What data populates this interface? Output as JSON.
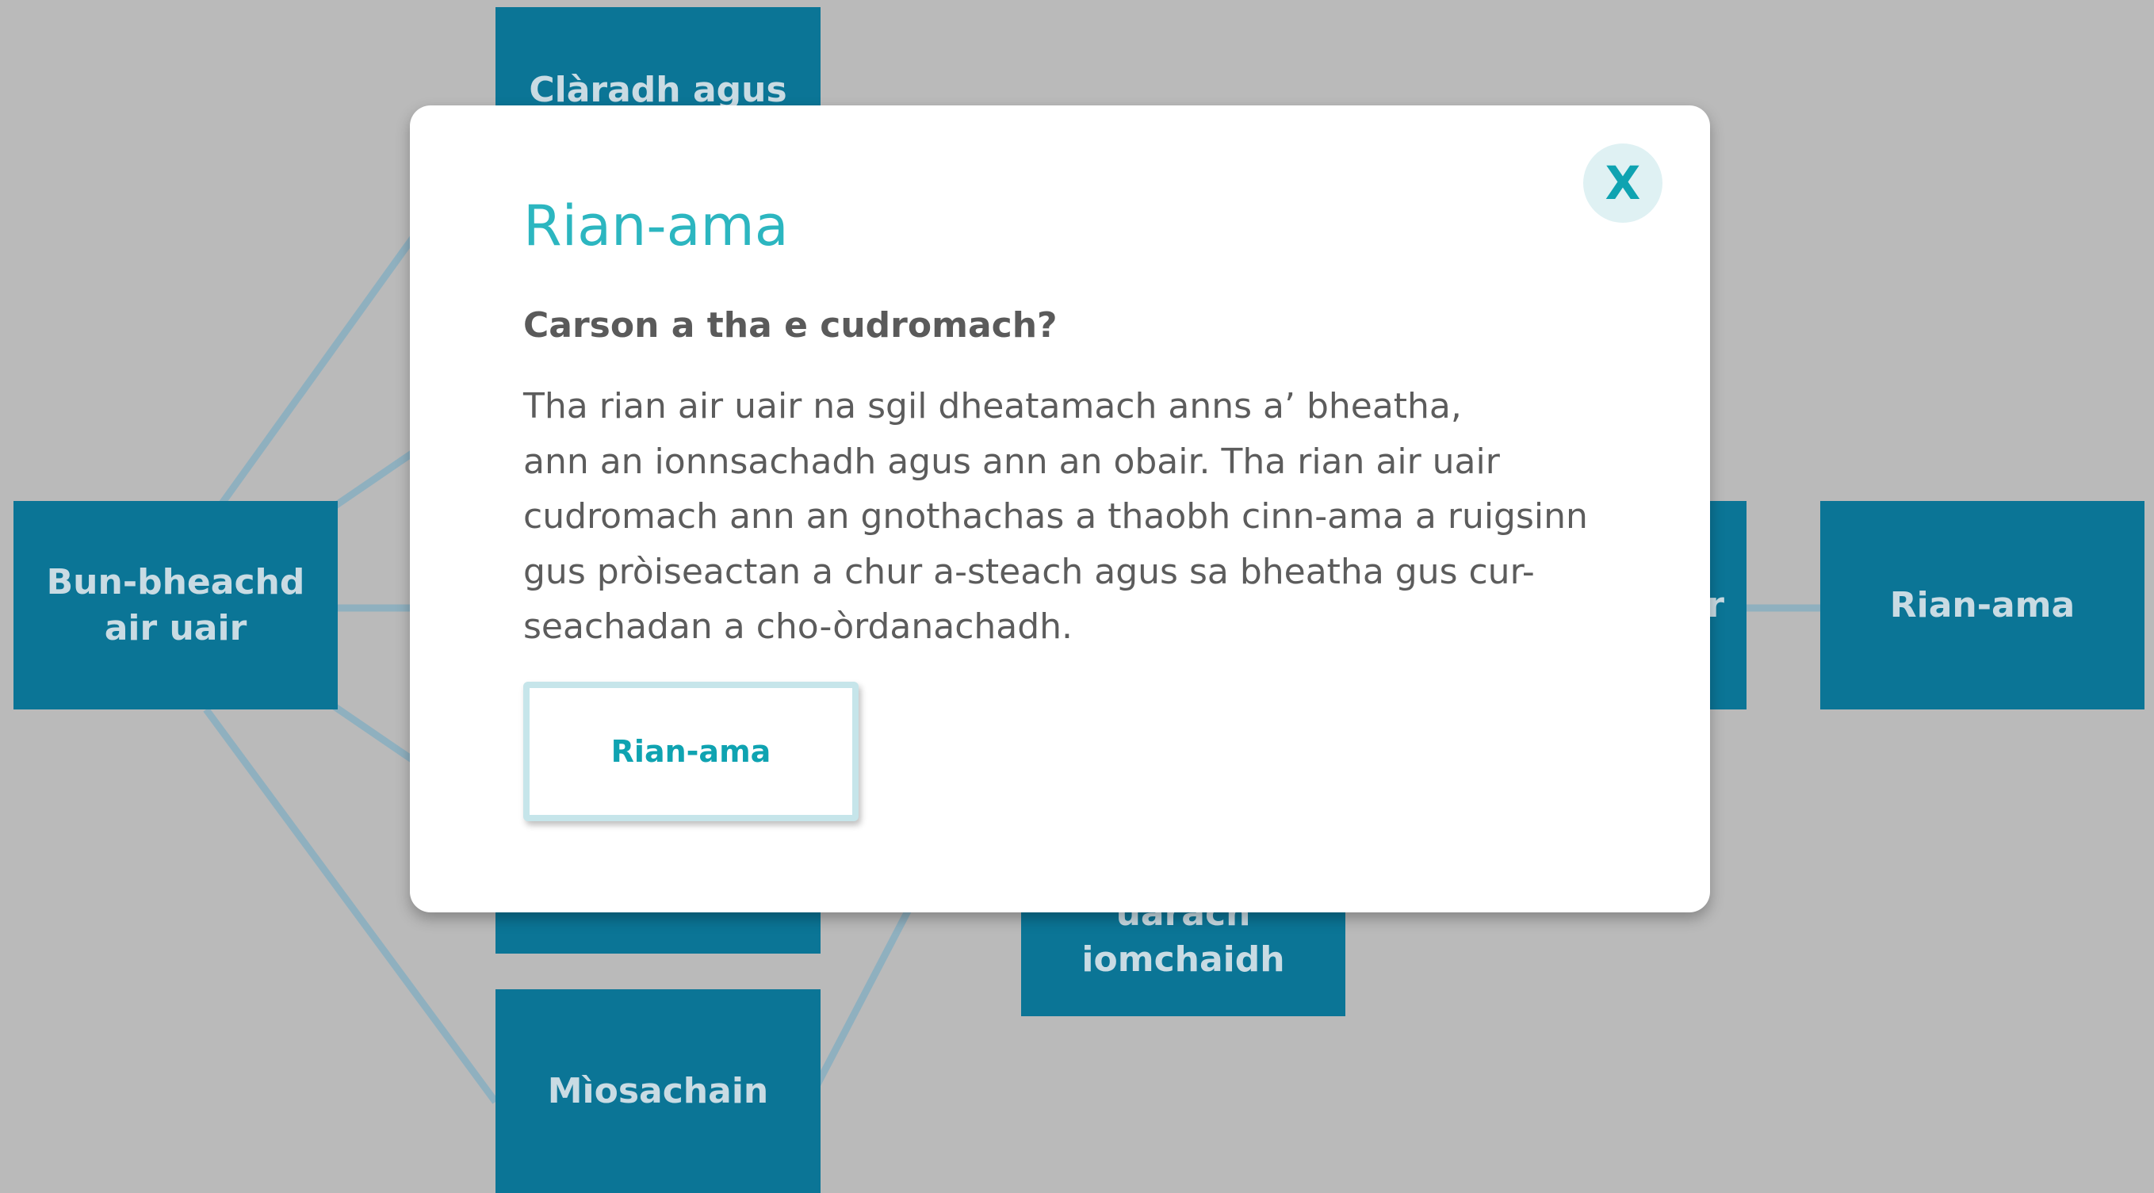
{
  "background_nodes": {
    "top_center": "Clàradh agus",
    "left": [
      "Bun-bheachd",
      "air uair"
    ],
    "right_partial": "ar",
    "right": "Rian-ama",
    "bottom_center_lines": [
      "aonadan uarach",
      "iomchaidh"
    ],
    "bottom_left": "Mìosachain"
  },
  "modal": {
    "title": "Rian-ama",
    "subtitle": "Carson a tha e cudromach?",
    "body_lines": [
      "Tha rian air uair na sgil dheatamach anns a’ bheatha,",
      "ann an ionnsachadh agus ann an obair. Tha rian air uair",
      "cudromach ann an gnothachas a thaobh cinn-ama a ruigsinn",
      "gus pròiseactan a chur a-steach agus sa bheatha gus cur-",
      "seachadan a cho-òrdanachadh."
    ],
    "button_label": "Rian-ama",
    "close_label": "X"
  },
  "colors": {
    "background": "#bababa",
    "node": "#0b7596",
    "node_text": "#c9dbe3",
    "connector": "#8fb0bf",
    "accent": "#2cb6c0",
    "close_bg": "#dff1f3"
  },
  "icons": {
    "close": "close-icon"
  }
}
